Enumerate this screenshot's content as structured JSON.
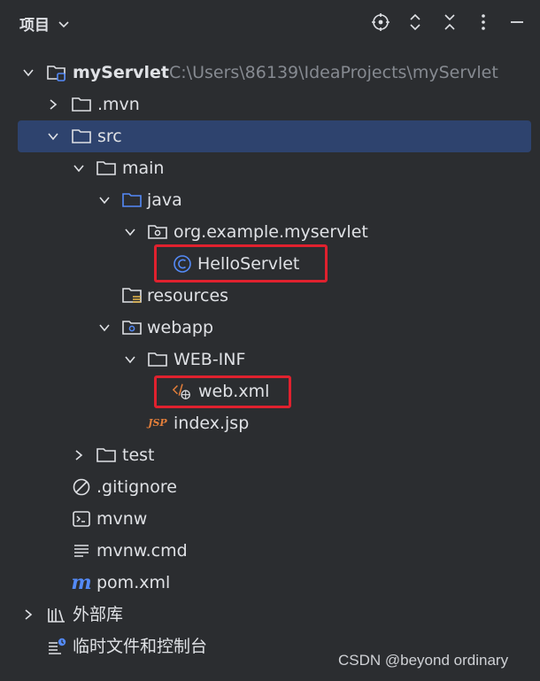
{
  "header": {
    "title": "项目",
    "tools": [
      "locate-icon",
      "expand-all-icon",
      "collapse-all-icon",
      "more-icon",
      "minimize-icon"
    ]
  },
  "tree": {
    "root": {
      "name": "myServlet",
      "path": "C:\\Users\\86139\\IdeaProjects\\myServlet"
    },
    "mvn": ".mvn",
    "src": "src",
    "main": "main",
    "java": "java",
    "package": "org.example.myservlet",
    "servlet": "HelloServlet",
    "resources": "resources",
    "webapp": "webapp",
    "webinf": "WEB-INF",
    "webxml": "web.xml",
    "indexjsp": "index.jsp",
    "jsp_badge": "JSP",
    "test": "test",
    "gitignore": ".gitignore",
    "mvnw": "mvnw",
    "mvnwcmd": "mvnw.cmd",
    "pom": "pom.xml",
    "external_libs": "外部库",
    "scratches": "临时文件和控制台"
  },
  "watermark": "CSDN @beyond ordinary",
  "colors": {
    "background": "#2b2d30",
    "selection": "#2e436e",
    "highlight_box": "#e0212e",
    "source_folder": "#548af7",
    "class_icon": "#548af7",
    "jsp_icon": "#e57f3a"
  }
}
